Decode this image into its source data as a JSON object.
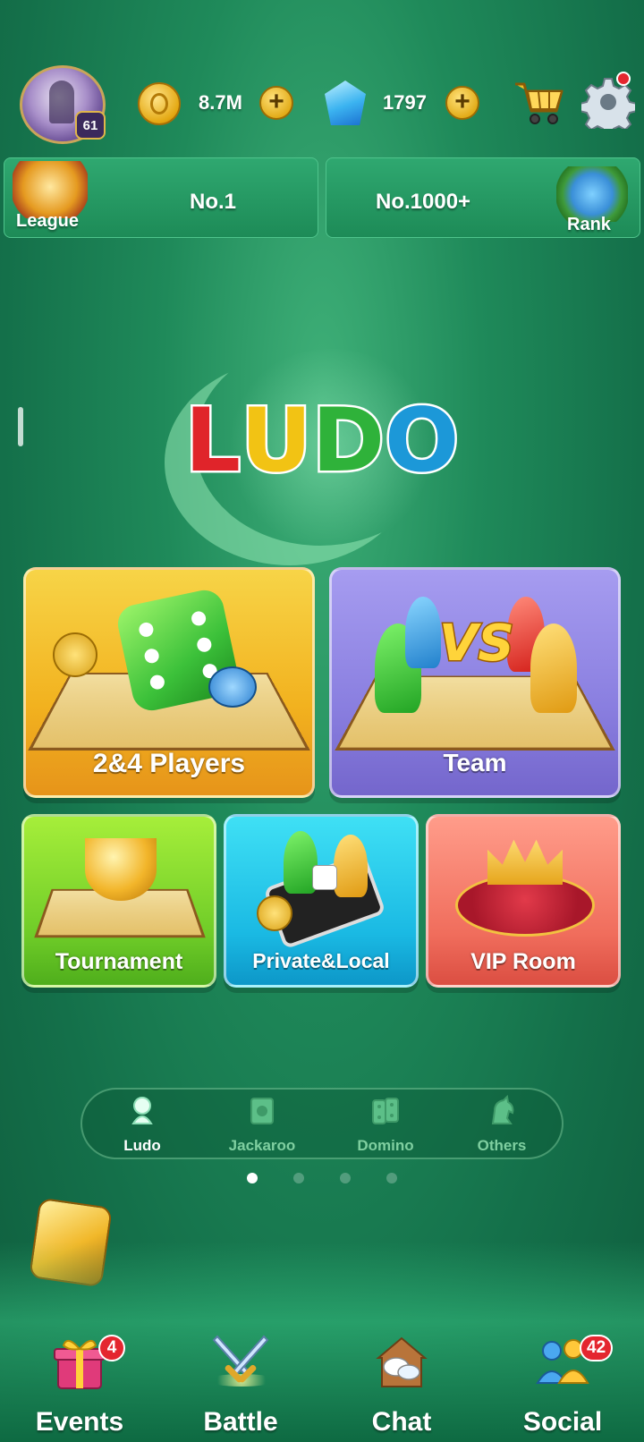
{
  "header": {
    "level": "61",
    "coins": "8.7M",
    "gems": "1797",
    "icons": {
      "avatar": "player-avatar",
      "coin": "gold-coin-icon",
      "gem": "blue-gem-icon",
      "shop": "shopping-cart-icon",
      "settings": "gear-icon"
    }
  },
  "ranking": {
    "league_label": "League",
    "league_value": "No.1",
    "rank_value": "No.1000+",
    "rank_label": "Rank"
  },
  "logo": {
    "letters": [
      "L",
      "U",
      "D",
      "O"
    ],
    "colors": [
      "#e0242a",
      "#f2c314",
      "#2fb23a",
      "#1c98d8"
    ]
  },
  "modes": {
    "players": "2&4 Players",
    "team": "Team",
    "vs_text": "VS",
    "tournament": "Tournament",
    "private": "Private&Local",
    "vip": "VIP Room"
  },
  "game_tabs": [
    {
      "label": "Ludo",
      "active": true
    },
    {
      "label": "Jackaroo",
      "active": false
    },
    {
      "label": "Domino",
      "active": false
    },
    {
      "label": "Others",
      "active": false
    }
  ],
  "bottom_nav": {
    "events": {
      "label": "Events",
      "badge": "4"
    },
    "battle": {
      "label": "Battle"
    },
    "chat": {
      "label": "Chat"
    },
    "social": {
      "label": "Social",
      "badge": "42"
    }
  },
  "colors": {
    "accent_gold": "#f2b21f",
    "notification_red": "#e4262f",
    "background_green": "#1f8a5a"
  }
}
